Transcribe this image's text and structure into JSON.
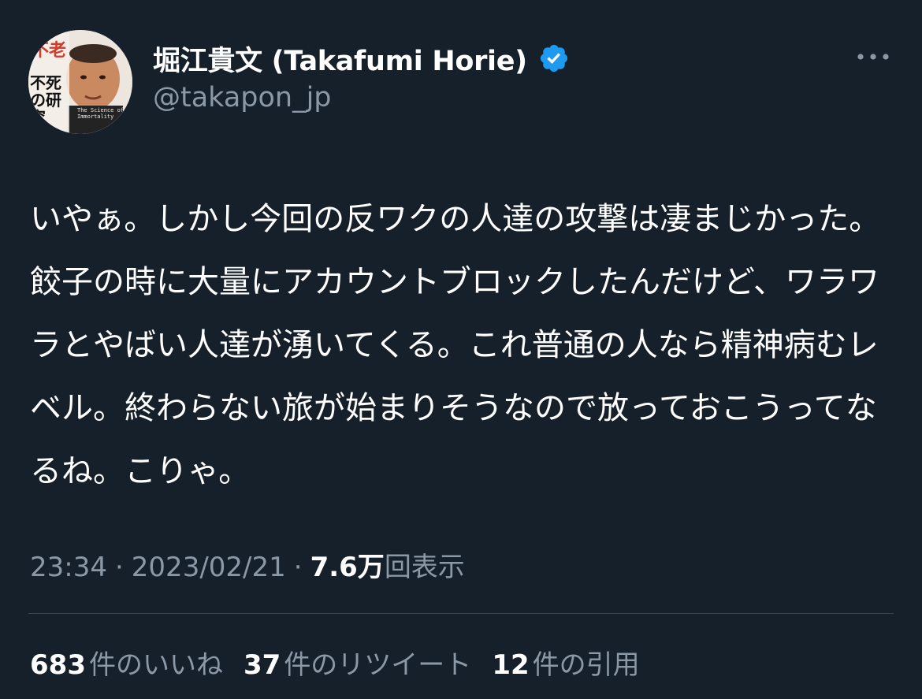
{
  "author": {
    "display_name": "堀江貴文 (Takafumi Horie)",
    "handle": "@takapon_jp",
    "verified": true,
    "verified_color": "#1d9bf0",
    "avatar_text": {
      "title_red": "不老",
      "title_black": "不死の研究",
      "subtitle": "The Science of Immortality"
    }
  },
  "more_icon": "more-horizontal-icon",
  "tweet": {
    "text": "いやぁ。しかし今回の反ワクの人達の攻撃は凄まじかった。餃子の時に大量にアカウントブロックしたんだけど、ワラワラとやばい人達が湧いてくる。これ普通の人なら精神病むレベル。終わらない旅が始まりそうなので放っておこうってなるね。こりゃ。",
    "time": "23:34",
    "separator": "·",
    "date": "2023/02/21",
    "views_count": "7.6万",
    "views_label": "回表示"
  },
  "stats": [
    {
      "count": "683",
      "label": "件のいいね"
    },
    {
      "count": "37",
      "label": "件のリツイート"
    },
    {
      "count": "12",
      "label": "件の引用"
    }
  ],
  "colors": {
    "background": "#15202b",
    "text": "#ffffff",
    "secondary": "#8b98a5",
    "divider": "#38444d"
  }
}
